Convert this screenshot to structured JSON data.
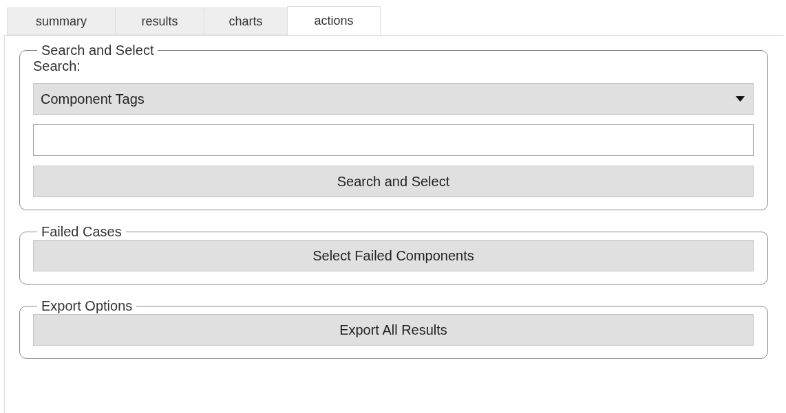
{
  "tabs": [
    {
      "label": "summary",
      "selected": false
    },
    {
      "label": "results",
      "selected": false
    },
    {
      "label": "charts",
      "selected": false
    },
    {
      "label": "actions",
      "selected": true
    }
  ],
  "groups": [
    {
      "legend": "Search and Select",
      "kind": "search",
      "label": "Search:",
      "select": {
        "value": "Component Tags"
      },
      "button": "Search and Select"
    },
    {
      "legend": "Failed Cases",
      "kind": "button",
      "button": "Select Failed Components"
    },
    {
      "legend": "Export Options",
      "kind": "button",
      "button": "Export All Results"
    }
  ]
}
